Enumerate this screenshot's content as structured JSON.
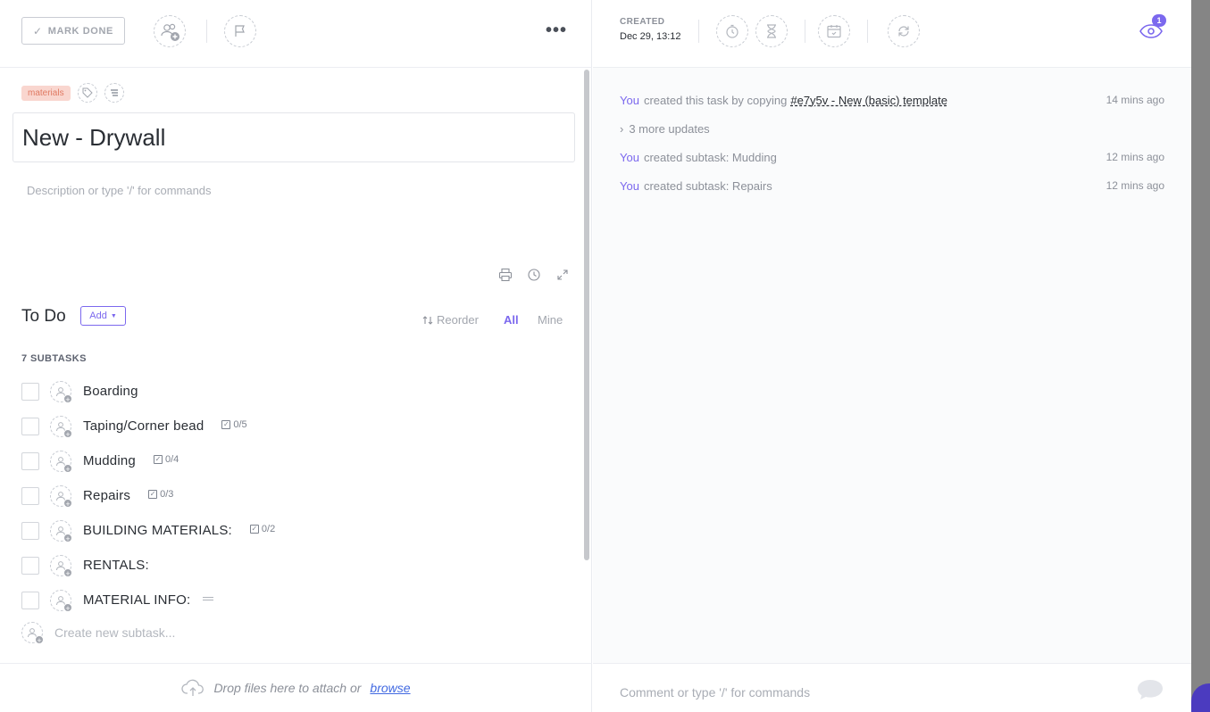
{
  "toolbar": {
    "mark_done_label": "MARK DONE",
    "more_icon": "•••"
  },
  "tags": {
    "items": [
      {
        "label": "materials",
        "color": "#f9d6cf",
        "text_color": "#e07a63"
      }
    ]
  },
  "task": {
    "title": "New - Drywall",
    "description_placeholder": "Description or type '/' for commands"
  },
  "todo": {
    "title": "To Do",
    "add_label": "Add",
    "reorder_label": "Reorder",
    "filter_all": "All",
    "filter_mine": "Mine",
    "subtask_count_label": "7 SUBTASKS",
    "subtasks": [
      {
        "name": "Boarding",
        "checklist": ""
      },
      {
        "name": "Taping/Corner bead",
        "checklist": "0/5"
      },
      {
        "name": "Mudding",
        "checklist": "0/4"
      },
      {
        "name": "Repairs",
        "checklist": "0/3"
      },
      {
        "name": "BUILDING MATERIALS:",
        "checklist": "0/2"
      },
      {
        "name": "RENTALS:",
        "checklist": ""
      },
      {
        "name": "MATERIAL INFO:",
        "checklist": "",
        "has_description": true
      }
    ],
    "create_placeholder": "Create new subtask..."
  },
  "attachments": {
    "drop_text": "Drop files here to attach or",
    "browse_label": "browse"
  },
  "meta": {
    "created_label": "CREATED",
    "created_date": "Dec 29, 13:12",
    "watchers_count": "1"
  },
  "activity": {
    "rows": [
      {
        "actor": "You",
        "text": "created this task by copying",
        "link": "#e7y5v - New (basic) template",
        "time": "14 mins ago"
      },
      {
        "actor": "You",
        "text": "created subtask: Mudding",
        "link": "",
        "time": "12 mins ago"
      },
      {
        "actor": "You",
        "text": "created subtask: Repairs",
        "link": "",
        "time": "12 mins ago"
      }
    ],
    "more_updates": "3 more updates"
  },
  "comment": {
    "placeholder": "Comment or type '/' for commands"
  },
  "colors": {
    "accent": "#7b68ee",
    "link": "#4169e1"
  }
}
